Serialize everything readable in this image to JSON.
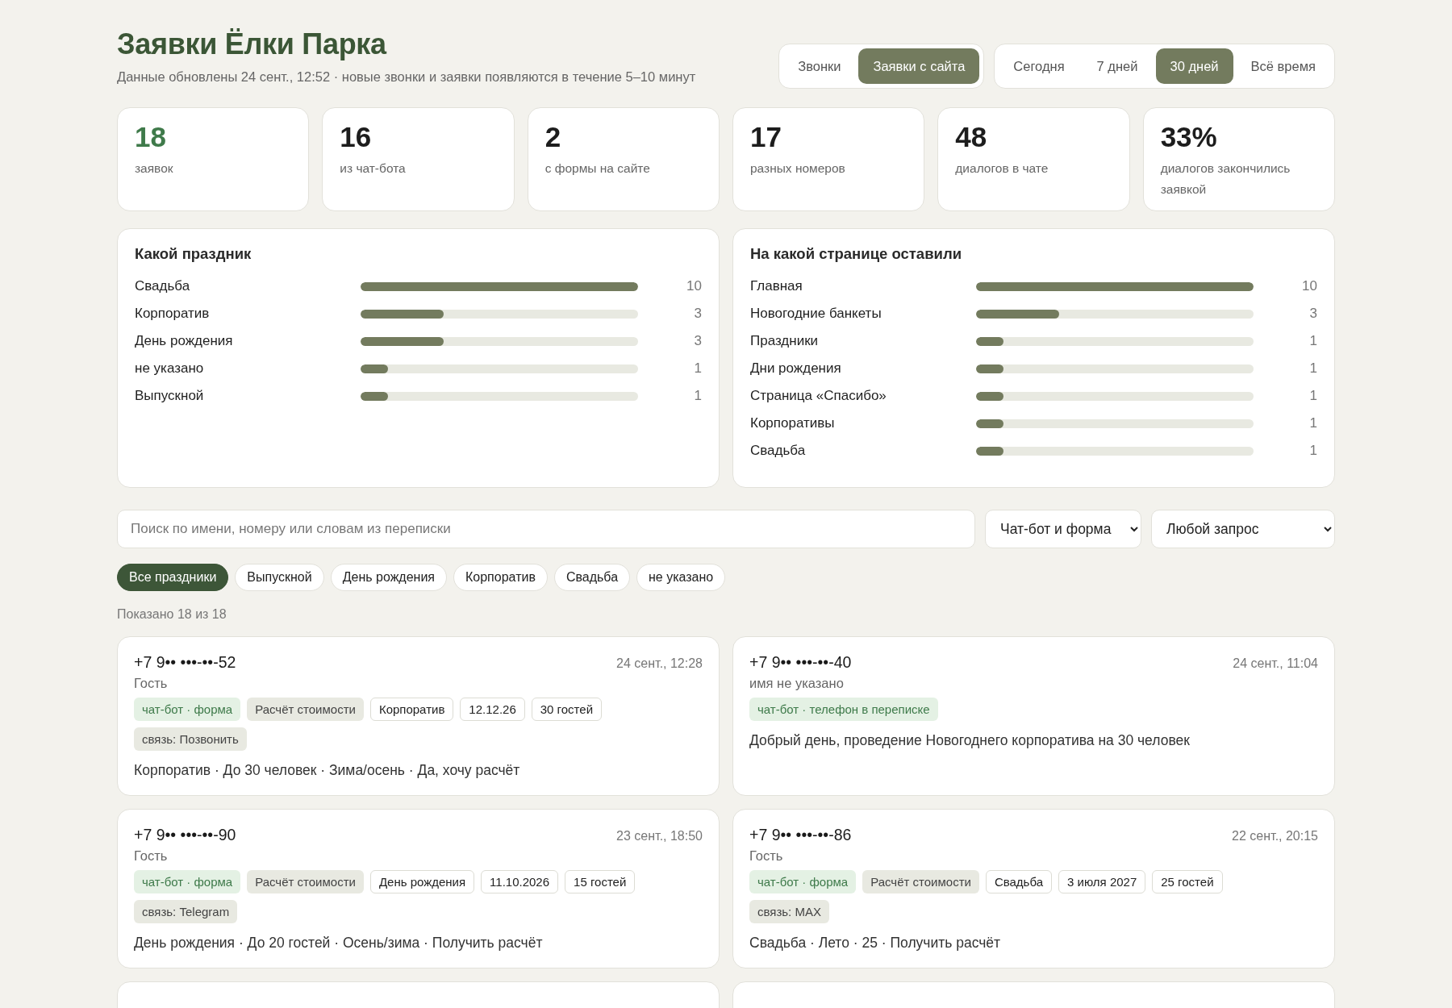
{
  "header": {
    "title": "Заявки Ёлки Парка",
    "subtitle": "Данные обновлены 24 сент., 12:52 · новые звонки и заявки появляются в течение 5–10 минут"
  },
  "mode_tabs": [
    {
      "label": "Звонки",
      "selected": false
    },
    {
      "label": "Заявки с сайта",
      "selected": true
    }
  ],
  "period_tabs": [
    {
      "label": "Сегодня",
      "selected": false
    },
    {
      "label": "7 дней",
      "selected": false
    },
    {
      "label": "30 дней",
      "selected": true
    },
    {
      "label": "Всё время",
      "selected": false
    }
  ],
  "stats": [
    {
      "value": "18",
      "label": "заявок",
      "accent": true
    },
    {
      "value": "16",
      "label": "из чат-бота",
      "accent": false
    },
    {
      "value": "2",
      "label": "с формы на сайте",
      "accent": false
    },
    {
      "value": "17",
      "label": "разных номеров",
      "accent": false
    },
    {
      "value": "48",
      "label": "диалогов в чате",
      "accent": false
    },
    {
      "value": "33%",
      "label": "диалогов закончились заявкой",
      "accent": false
    }
  ],
  "breakdowns": [
    {
      "title": "Какой праздник",
      "rows": [
        {
          "label": "Свадьба",
          "value": "10",
          "level": 1
        },
        {
          "label": "Корпоратив",
          "value": "3",
          "level": 0.3
        },
        {
          "label": "День рождения",
          "value": "3",
          "level": 0.3
        },
        {
          "label": "не указано",
          "value": "1",
          "level": 0.1
        },
        {
          "label": "Выпускной",
          "value": "1",
          "level": 0.1
        }
      ]
    },
    {
      "title": "На какой странице оставили",
      "rows": [
        {
          "label": "Главная",
          "value": "10",
          "level": 1
        },
        {
          "label": "Новогодние банкеты",
          "value": "3",
          "level": 0.3
        },
        {
          "label": "Праздники",
          "value": "1",
          "level": 0.1
        },
        {
          "label": "Дни рождения",
          "value": "1",
          "level": 0.1
        },
        {
          "label": "Страница «Спасибо»",
          "value": "1",
          "level": 0.1
        },
        {
          "label": "Корпоративы",
          "value": "1",
          "level": 0.1
        },
        {
          "label": "Свадьба",
          "value": "1",
          "level": 0.1
        }
      ]
    }
  ],
  "search": {
    "placeholder": "Поиск по имени, номеру или словам из переписки"
  },
  "selects": [
    "Чат-бот и форма",
    "Любой запрос"
  ],
  "chips": [
    {
      "label": "Все праздники",
      "selected": true
    },
    {
      "label": "Выпускной",
      "selected": false
    },
    {
      "label": "День рождения",
      "selected": false
    },
    {
      "label": "Корпоратив",
      "selected": false
    },
    {
      "label": "Свадьба",
      "selected": false
    },
    {
      "label": "не указано",
      "selected": false
    }
  ],
  "shown": "Показано 18 из 18",
  "leads": [
    {
      "phone": "+7 9•• •••-••-52",
      "time": "24 сент., 12:28",
      "name": "Гость",
      "tags": [
        {
          "kind": "source",
          "text": "чат-бот · форма"
        },
        {
          "kind": "type",
          "text": "Расчёт стоимости"
        },
        {
          "kind": "plain",
          "text": "Корпоратив"
        },
        {
          "kind": "plain",
          "text": "12.12.26"
        },
        {
          "kind": "plain",
          "text": "30 гостей"
        },
        {
          "kind": "contact",
          "text": "связь: Позвонить"
        }
      ],
      "summary": "Корпоратив · До 30 человек · Зима/осень · Да, хочу расчёт"
    },
    {
      "phone": "+7 9•• •••-••-40",
      "time": "24 сент., 11:04",
      "name": "имя не указано",
      "tags": [
        {
          "kind": "source",
          "text": "чат-бот · телефон в переписке"
        }
      ],
      "summary": "Добрый день, проведение Новогоднего корпоратива на 30 человек"
    },
    {
      "phone": "+7 9•• •••-••-90",
      "time": "23 сент., 18:50",
      "name": "Гость",
      "tags": [
        {
          "kind": "source",
          "text": "чат-бот · форма"
        },
        {
          "kind": "type",
          "text": "Расчёт стоимости"
        },
        {
          "kind": "plain",
          "text": "День рождения"
        },
        {
          "kind": "plain",
          "text": "11.10.2026"
        },
        {
          "kind": "plain",
          "text": "15 гостей"
        },
        {
          "kind": "contact",
          "text": "связь: Telegram"
        }
      ],
      "summary": "День рождения · До 20 гостей · Осень/зима · Получить расчёт"
    },
    {
      "phone": "+7 9•• •••-••-86",
      "time": "22 сент., 20:15",
      "name": "Гость",
      "tags": [
        {
          "kind": "source",
          "text": "чат-бот · форма"
        },
        {
          "kind": "type",
          "text": "Расчёт стоимости"
        },
        {
          "kind": "plain",
          "text": "Свадьба"
        },
        {
          "kind": "plain",
          "text": "3 июля 2027"
        },
        {
          "kind": "plain",
          "text": "25 гостей"
        },
        {
          "kind": "contact",
          "text": "связь: MAX"
        }
      ],
      "summary": "Свадьба · Лето · 25 · Получить расчёт"
    }
  ]
}
